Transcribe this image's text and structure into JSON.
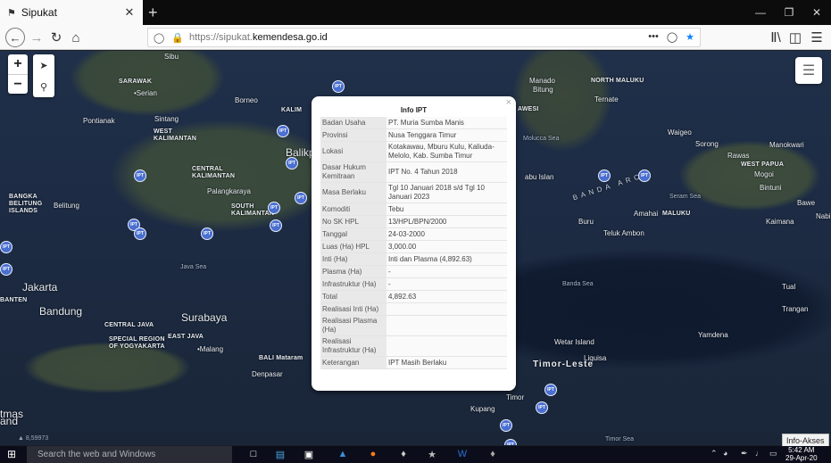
{
  "browser": {
    "tab_title": "Sipukat",
    "url_prefix": "https://sipukat.",
    "url_domain": "kemendesa.go.id",
    "url_tail": "",
    "more_label": "•••"
  },
  "map": {
    "labels": [
      {
        "text": "SARAWAK",
        "cls": "b"
      },
      {
        "text": "•Serian",
        "cls": ""
      },
      {
        "text": "Sibu",
        "cls": ""
      },
      {
        "text": "Borneo",
        "cls": ""
      },
      {
        "text": "Pontianak",
        "cls": ""
      },
      {
        "text": "Sintang",
        "cls": ""
      },
      {
        "text": "WEST\nKALIMANTAN",
        "cls": "b"
      },
      {
        "text": "CENTRAL\nKALIMANTAN",
        "cls": "b"
      },
      {
        "text": "Palangkaraya",
        "cls": ""
      },
      {
        "text": "SOUTH\nKALIMANTAN",
        "cls": "b"
      },
      {
        "text": "Belitung",
        "cls": ""
      },
      {
        "text": "BANGKA\nBELITUNG\nISLANDS",
        "cls": "b"
      },
      {
        "text": "Java Sea",
        "cls": "sea"
      },
      {
        "text": "Jakarta",
        "cls": "big"
      },
      {
        "text": "BANTEN",
        "cls": "b"
      },
      {
        "text": "Bandung",
        "cls": "big"
      },
      {
        "text": "CENTRAL JAVA",
        "cls": "b"
      },
      {
        "text": "Surabaya",
        "cls": "big"
      },
      {
        "text": "EAST JAVA",
        "cls": "b"
      },
      {
        "text": "SPECIAL REGION\nOF YOGYAKARTA",
        "cls": "b"
      },
      {
        "text": "•Malang",
        "cls": ""
      },
      {
        "text": "BALI Mataram",
        "cls": "b"
      },
      {
        "text": "Denpasar",
        "cls": ""
      },
      {
        "text": "KALIM",
        "cls": "b"
      },
      {
        "text": "Balikp",
        "cls": "big"
      },
      {
        "text": "Manado",
        "cls": ""
      },
      {
        "text": "Bitung",
        "cls": ""
      },
      {
        "text": "NORTH MALUKU",
        "cls": "b"
      },
      {
        "text": "Ternate",
        "cls": ""
      },
      {
        "text": "AWESI",
        "cls": "b"
      },
      {
        "text": "Molucca Sea",
        "cls": "sea"
      },
      {
        "text": "Waigeo",
        "cls": ""
      },
      {
        "text": "Sorong",
        "cls": ""
      },
      {
        "text": "Manokwari",
        "cls": ""
      },
      {
        "text": "Rawas",
        "cls": ""
      },
      {
        "text": "WEST PAPUA",
        "cls": "b"
      },
      {
        "text": "Mogoi",
        "cls": ""
      },
      {
        "text": "Bintuni",
        "cls": ""
      },
      {
        "text": "Bawe",
        "cls": ""
      },
      {
        "text": "Kaimana",
        "cls": ""
      },
      {
        "text": "Nabi",
        "cls": ""
      },
      {
        "text": "Seram Sea",
        "cls": "sea"
      },
      {
        "text": "Buru",
        "cls": ""
      },
      {
        "text": "Amahai",
        "cls": ""
      },
      {
        "text": "MALUKU",
        "cls": "b"
      },
      {
        "text": "Teluk Ambon",
        "cls": ""
      },
      {
        "text": "Banda Sea",
        "cls": "sea"
      },
      {
        "text": "Tual",
        "cls": ""
      },
      {
        "text": "Trangan",
        "cls": ""
      },
      {
        "text": "Yamdena",
        "cls": ""
      },
      {
        "text": "Wetar Island",
        "cls": ""
      },
      {
        "text": "Liquisa",
        "cls": ""
      },
      {
        "text": "Timor-Leste",
        "cls": "timor"
      },
      {
        "text": "Timor",
        "cls": ""
      },
      {
        "text": "Kupang",
        "cls": ""
      },
      {
        "text": "Timor Sea",
        "cls": "sea"
      },
      {
        "text": "abu Islan",
        "cls": ""
      },
      {
        "text": "BANDA ARC",
        "cls": "arc"
      },
      {
        "text": "tmas\nand",
        "cls": "big"
      }
    ],
    "coord_readout": "▲ 8,59973",
    "info_akses": "Info-Akses",
    "layers_icon": "layers-icon"
  },
  "popup": {
    "title": "Info IPT",
    "close": "×",
    "rows": [
      {
        "key": "Badan Usaha",
        "value": "PT. Muria Sumba Manis",
        "h": "n"
      },
      {
        "key": "Provinsi",
        "value": "Nusa Tenggara Timur",
        "h": "n"
      },
      {
        "key": "Lokasi",
        "value": "Kotakawau, Mburu Kulu, Kaliuda-Melolo, Kab. Sumba Timur",
        "h": "tall"
      },
      {
        "key": "Dasar Hukum Kemitraan",
        "value": "IPT No. 4 Tahun 2018",
        "h": "tall"
      },
      {
        "key": "Masa Berlaku",
        "value": "Tgl 10 Januari 2018 s/d Tgl 10 Januari 2023",
        "h": "tall"
      },
      {
        "key": "Komoditi",
        "value": "Tebu",
        "h": "n"
      },
      {
        "key": "No SK HPL",
        "value": "13/HPL/BPN/2000",
        "h": "n"
      },
      {
        "key": "Tanggal",
        "value": "24-03-2000",
        "h": "n"
      },
      {
        "key": "Luas (Ha) HPL",
        "value": "3,000.00",
        "h": "n"
      },
      {
        "key": "Inti (Ha)",
        "value": "Inti dan Plasma (4,892.63)",
        "h": "n"
      },
      {
        "key": "Plasma (Ha)",
        "value": "-",
        "h": "n"
      },
      {
        "key": "Infrastruktur (Ha)",
        "value": "-",
        "h": "n"
      },
      {
        "key": "Total",
        "value": "4,892.63",
        "h": "n"
      },
      {
        "key": "Realisasi Inti (Ha)",
        "value": "",
        "h": "n"
      },
      {
        "key": "Realisasi Plasma (Ha)",
        "value": "",
        "h": "tall"
      },
      {
        "key": "Realisasi Infrastruktur (Ha)",
        "value": "",
        "h": "tall"
      },
      {
        "key": "Keterangan",
        "value": "IPT Masih Berlaku",
        "h": "n"
      }
    ]
  },
  "taskbar": {
    "search_placeholder": "Search the web and Windows",
    "time": "5:42 AM",
    "date": "29-Apr-20"
  }
}
